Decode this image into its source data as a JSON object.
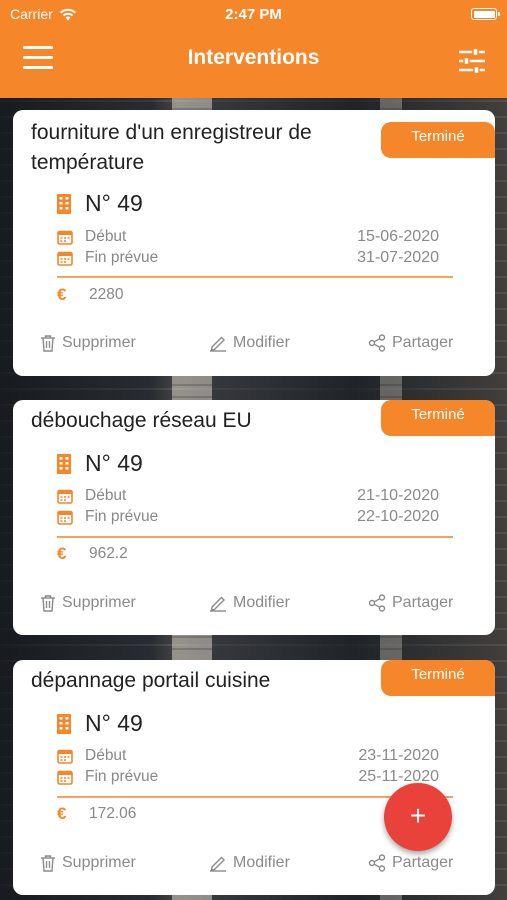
{
  "status_bar": {
    "carrier": "Carrier",
    "time": "2:47 PM"
  },
  "header": {
    "title": "Interventions",
    "menu_icon": "hamburger-menu-icon",
    "filter_icon": "sliders-filter-icon"
  },
  "colors": {
    "accent": "#f5862a",
    "fab": "#e8423a",
    "card_bg": "#ffffff",
    "text_muted": "#8a8a8a"
  },
  "cards": [
    {
      "title_line1": "fourniture d'un enregistreur de",
      "title_line2": "température",
      "status": "Terminé",
      "number": "N° 49",
      "start_label": "Début",
      "start_date": "15-06-2020",
      "end_label": "Fin prévue",
      "end_date": "31-07-2020",
      "currency": "€",
      "amount": "2280",
      "delete_label": "Supprimer",
      "edit_label": "Modifier",
      "share_label": "Partager"
    },
    {
      "title_line1": "débouchage réseau EU",
      "title_line2": "",
      "status": "Terminé",
      "number": "N° 49",
      "start_label": "Début",
      "start_date": "21-10-2020",
      "end_label": "Fin prévue",
      "end_date": "22-10-2020",
      "currency": "€",
      "amount": "962.2",
      "delete_label": "Supprimer",
      "edit_label": "Modifier",
      "share_label": "Partager"
    },
    {
      "title_line1": "dépannage portail cuisine",
      "title_line2": "",
      "status": "Terminé",
      "number": "N° 49",
      "start_label": "Début",
      "start_date": "23-11-2020",
      "end_label": "Fin prévue",
      "end_date": "25-11-2020",
      "currency": "€",
      "amount": "172.06",
      "delete_label": "Supprimer",
      "edit_label": "Modifier",
      "share_label": "Partager"
    }
  ],
  "fab": {
    "label": "+"
  }
}
